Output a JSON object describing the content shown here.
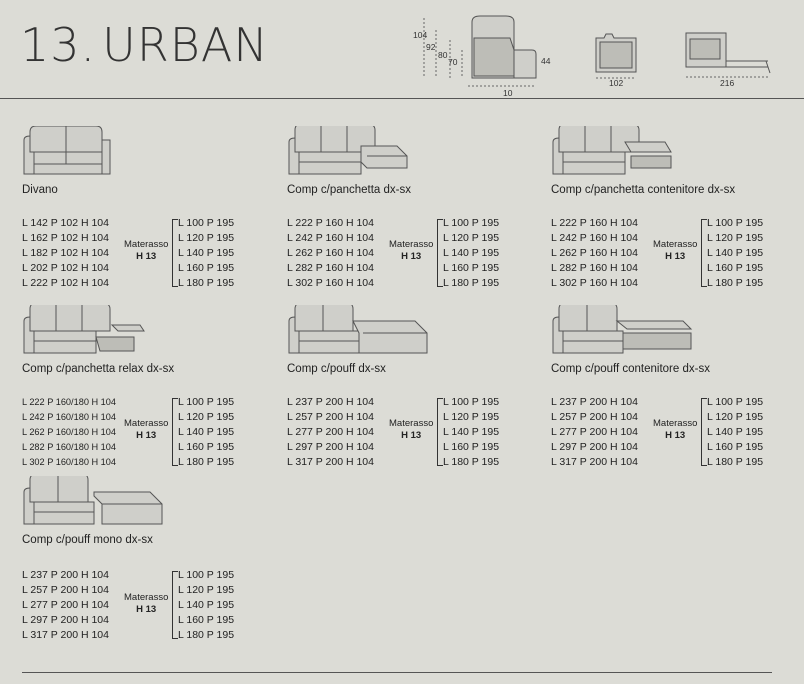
{
  "header": {
    "number": "13.",
    "title": "URBAN"
  },
  "dimensions": {
    "h104": "104",
    "h92": "92",
    "h80": "80",
    "h70": "70",
    "h44": "44",
    "depth": "10",
    "bed_depth": "102",
    "bed_length": "216"
  },
  "materasso": {
    "label": "Materasso",
    "h": "H 13"
  },
  "mattress_sizes": [
    "L 100 P 195",
    "L 120 P 195",
    "L 140 P 195",
    "L 160 P 195",
    "L 180 P 195"
  ],
  "items": [
    {
      "name": "Divano",
      "dims": [
        "L 142 P 102 H 104",
        "L 162 P 102 H 104",
        "L 182 P 102 H 104",
        "L 202 P 102 H 104",
        "L 222 P 102 H 104"
      ]
    },
    {
      "name": "Comp c/panchetta dx-sx",
      "dims": [
        "L 222 P 160 H 104",
        "L 242 P 160 H 104",
        "L 262 P 160 H 104",
        "L 282 P 160 H 104",
        "L 302 P 160 H 104"
      ]
    },
    {
      "name": "Comp c/panchetta contenitore dx-sx",
      "dims": [
        "L 222 P 160 H 104",
        "L 242 P 160 H 104",
        "L 262 P 160 H 104",
        "L 282 P 160 H 104",
        "L 302 P 160 H 104"
      ]
    },
    {
      "name": "Comp c/panchetta relax dx-sx",
      "dims": [
        "L 222 P 160/180 H 104",
        "L 242 P 160/180 H 104",
        "L 262 P 160/180 H 104",
        "L 282 P 160/180 H 104",
        "L 302 P 160/180 H 104"
      ]
    },
    {
      "name": "Comp c/pouff dx-sx",
      "dims": [
        "L 237 P 200 H 104",
        "L 257 P 200 H 104",
        "L 277 P 200 H 104",
        "L 297 P 200 H 104",
        "L 317 P 200 H 104"
      ]
    },
    {
      "name": "Comp c/pouff contenitore dx-sx",
      "dims": [
        "L 237 P 200 H 104",
        "L 257 P 200 H 104",
        "L 277 P 200 H 104",
        "L 297 P 200 H 104",
        "L 317 P 200 H 104"
      ]
    },
    {
      "name": "Comp c/pouff mono dx-sx",
      "dims": [
        "L 237 P 200 H 104",
        "L 257 P 200 H 104",
        "L 277 P 200 H 104",
        "L 297 P 200 H 104",
        "L 317 P 200 H 104"
      ]
    }
  ]
}
